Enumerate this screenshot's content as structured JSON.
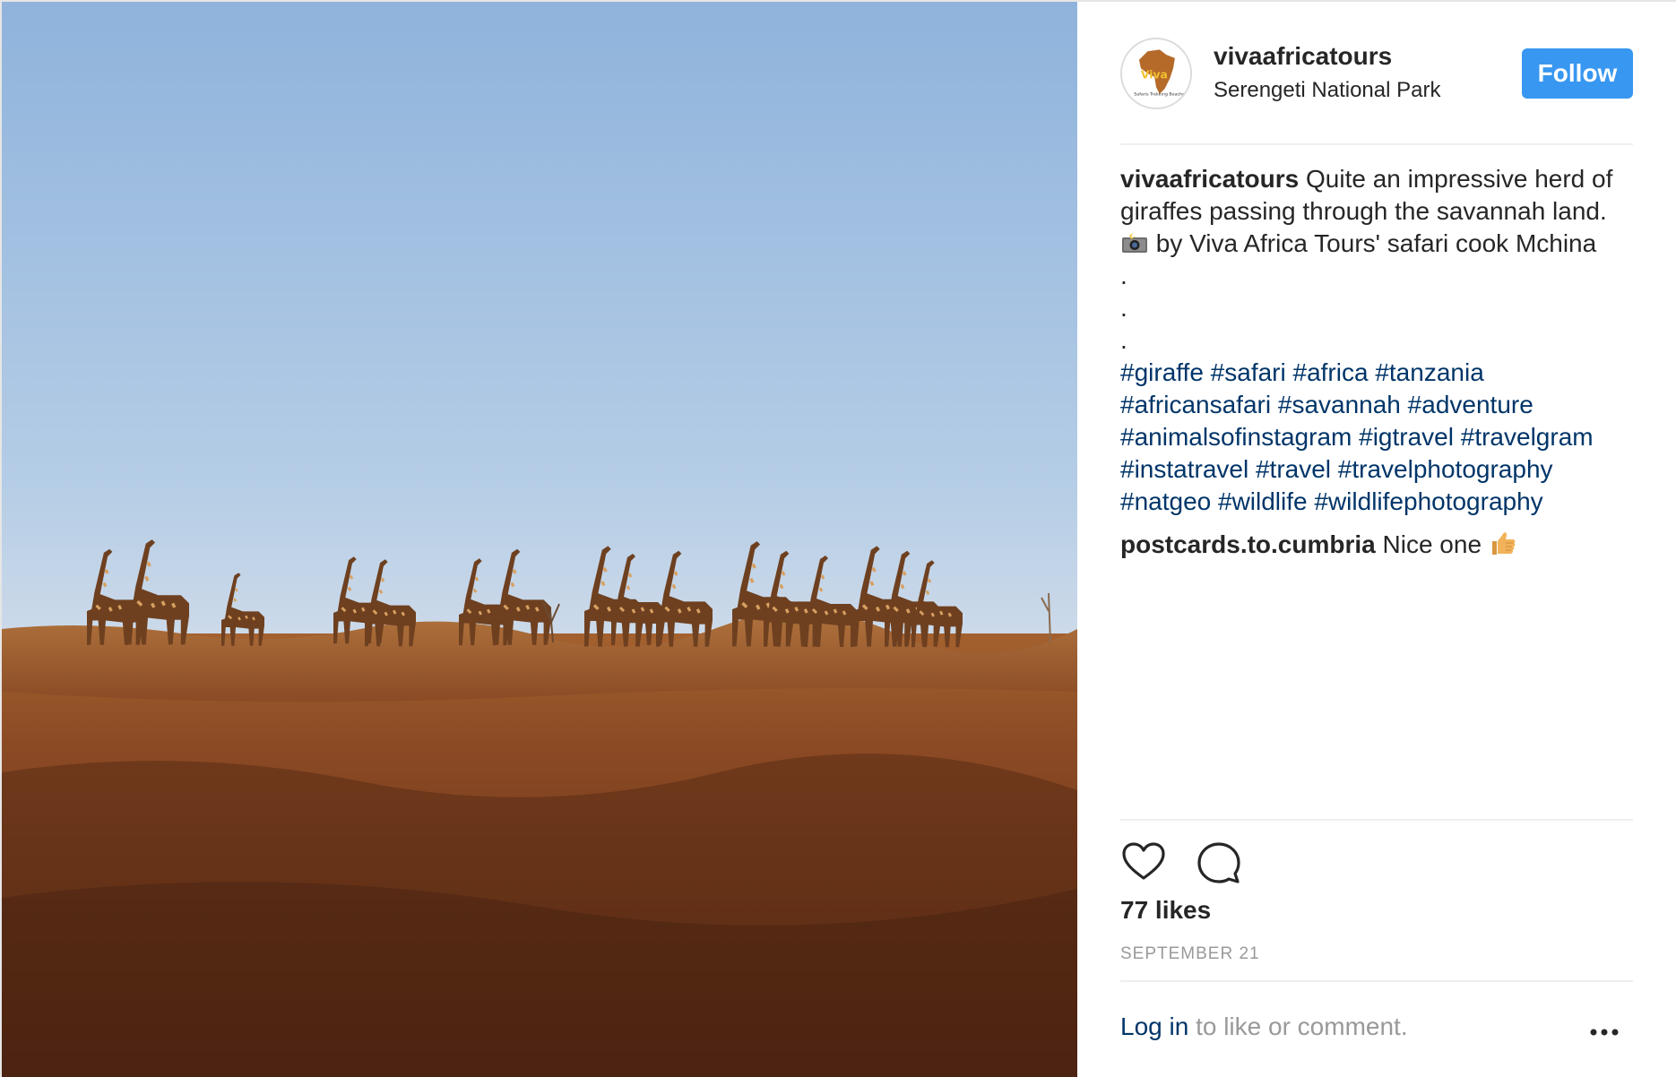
{
  "post": {
    "photo": {
      "alt_subject": "giraffe-herd-photo"
    },
    "header": {
      "username": "vivaafricatours",
      "location": "Serengeti National Park",
      "follow_label": "Follow",
      "avatar_icon": "viva-africa-tours-logo"
    },
    "caption": {
      "username": "vivaafricatours",
      "text_line1": "Quite an impressive herd of",
      "text_line2": "giraffes passing through the savannah land.",
      "text_line3": "by Viva Africa Tours' safari cook Mchina",
      "camera_icon": "camera-flash-icon",
      "dots": [
        ".",
        ".",
        "."
      ],
      "hashtag_lines": [
        [
          "#giraffe",
          "#safari",
          "#africa",
          "#tanzania"
        ],
        [
          "#africansafari",
          "#savannah",
          "#adventure"
        ],
        [
          "#animalsofinstagram",
          "#igtravel",
          "#travelgram"
        ],
        [
          "#instatravel",
          "#travel",
          "#travelphotography"
        ],
        [
          "#natgeo",
          "#wildlife",
          "#wildlifephotography"
        ]
      ]
    },
    "comment": {
      "username": "postcards.to.cumbria",
      "text": "Nice one",
      "emoji_icon": "thumbs-up-icon"
    },
    "actions": {
      "like_icon": "heart-icon",
      "comment_icon": "comment-bubble-icon"
    },
    "likes": "77 likes",
    "date": "SEPTEMBER 21",
    "login": {
      "link_label": "Log in",
      "rest_text": "to like or comment."
    },
    "more_icon": "more-options-icon",
    "colors": {
      "accent": "#3897f0",
      "link": "#003569",
      "muted": "#999999"
    }
  }
}
